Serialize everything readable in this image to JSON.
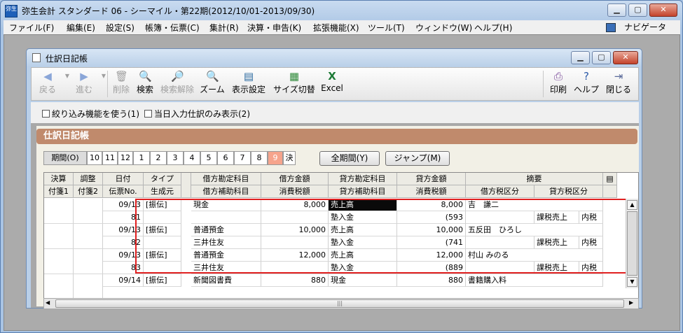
{
  "app": {
    "title": "弥生会計 スタンダード 06 - シーマイル・第22期(2012/10/01-2013/09/30)",
    "icon_text": "弥生",
    "window_buttons": [
      "minimize-icon",
      "maximize-icon",
      "close-icon"
    ]
  },
  "menubar": {
    "items": [
      {
        "label": "ファイル(F)"
      },
      {
        "label": "編集(E)"
      },
      {
        "label": "設定(S)"
      },
      {
        "label": "帳簿・伝票(C)"
      },
      {
        "label": "集計(R)"
      },
      {
        "label": "決算・申告(K)"
      },
      {
        "label": "拡張機能(X)"
      },
      {
        "label": "ツール(T)"
      },
      {
        "label": "ウィンドウ(W)"
      },
      {
        "label": "ヘルプ(H)"
      }
    ],
    "navigator": "ナビゲータ"
  },
  "window": {
    "title": "仕訳日記帳"
  },
  "toolbar": {
    "back": "戻る",
    "forward": "進む",
    "delete": "削除",
    "search": "検索",
    "clear_search": "検索解除",
    "zoom": "ズーム",
    "display_settings": "表示設定",
    "size_switch": "サイズ切替",
    "excel": "Excel",
    "print": "印刷",
    "help": "ヘルプ",
    "close": "閉じる"
  },
  "options": {
    "filter": "絞り込み機能を使う(1)",
    "today_only": "当日入力仕訳のみ表示(2)"
  },
  "section_title": "仕訳日記帳",
  "period": {
    "label": "期間(O)",
    "months": [
      "10",
      "11",
      "12",
      "1",
      "2",
      "3",
      "4",
      "5",
      "6",
      "7",
      "8",
      "9",
      "決"
    ],
    "selected": "9",
    "all_period_button": "全期間(Y)",
    "jump_button": "ジャンプ(M)"
  },
  "grid": {
    "header_top": [
      "決算",
      "調整",
      "日付",
      "タイプ",
      "借方勘定科目",
      "借方金額",
      "貸方勘定科目",
      "貸方金額",
      "摘要"
    ],
    "header_bottom": [
      "付箋1",
      "付箋2",
      "伝票No.",
      "生成元",
      "借方補助科目",
      "消費税額",
      "貸方補助科目",
      "消費税額",
      "借方税区分",
      "貸方税区分"
    ],
    "rows": [
      {
        "date": "09/13",
        "type": "[振伝]",
        "debit_account": "現金",
        "debit_amount": "8,000",
        "credit_account": "売上高",
        "credit_amount": "8,000",
        "memo": "吉　謙二",
        "no": "81",
        "debit_sub": "",
        "debit_tax": "",
        "credit_sub": "塾入金",
        "credit_tax": "(593",
        "debit_tax_class": "",
        "credit_tax_class": "課税売上",
        "credit_tax_class2": "内税"
      },
      {
        "date": "09/13",
        "type": "[振伝]",
        "debit_account": "普通預金",
        "debit_amount": "10,000",
        "credit_account": "売上高",
        "credit_amount": "10,000",
        "memo": "五反田　ひろし",
        "no": "82",
        "debit_sub": "三井住友",
        "debit_tax": "",
        "credit_sub": "塾入金",
        "credit_tax": "(741",
        "debit_tax_class": "",
        "credit_tax_class": "課税売上",
        "credit_tax_class2": "内税"
      },
      {
        "date": "09/13",
        "type": "[振伝]",
        "debit_account": "普通預金",
        "debit_amount": "12,000",
        "credit_account": "売上高",
        "credit_amount": "12,000",
        "memo": "村山 みのる",
        "no": "83",
        "debit_sub": "三井住友",
        "debit_tax": "",
        "credit_sub": "塾入金",
        "credit_tax": "(889",
        "debit_tax_class": "",
        "credit_tax_class": "課税売上",
        "credit_tax_class2": "内税"
      },
      {
        "date": "09/14",
        "type": "[振伝]",
        "debit_account": "新聞図書費",
        "debit_amount": "880",
        "credit_account": "現金",
        "credit_amount": "880",
        "memo": "書籍購入料",
        "no": "",
        "debit_sub": "",
        "debit_tax": "",
        "credit_sub": "",
        "credit_tax": "",
        "debit_tax_class": "",
        "credit_tax_class": "",
        "credit_tax_class2": ""
      }
    ]
  }
}
